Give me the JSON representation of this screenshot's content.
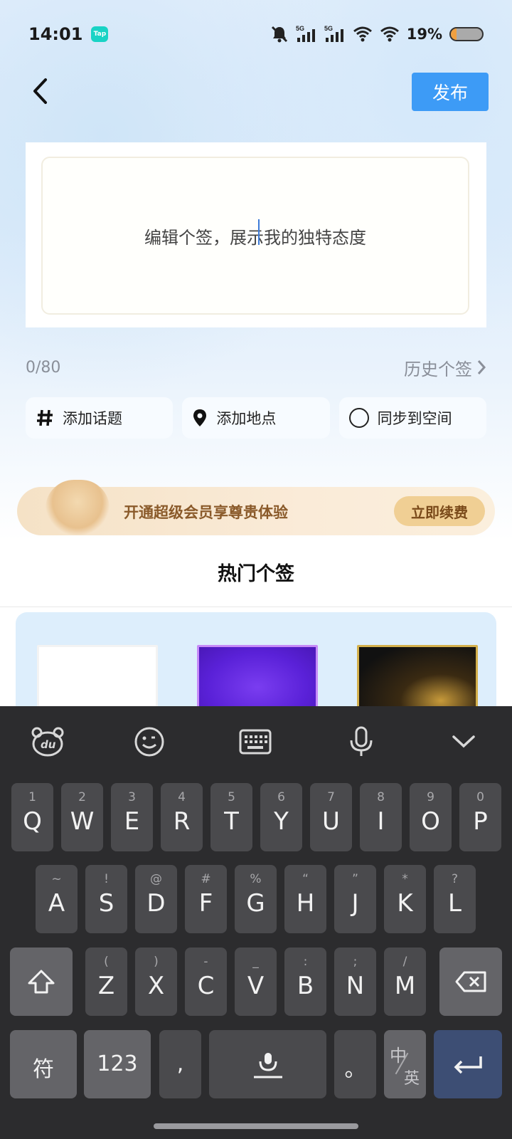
{
  "status_bar": {
    "time": "14:01",
    "app_badge": "Tap",
    "battery": "19%",
    "battery_level": 0.19
  },
  "header": {
    "publish_label": "发布"
  },
  "editor": {
    "placeholder": "编辑个签，展示我的独特态度"
  },
  "meta": {
    "counter": "0/80",
    "history_label": "历史个签"
  },
  "chips": [
    {
      "label": "添加话题",
      "icon": "hash-icon"
    },
    {
      "label": "添加地点",
      "icon": "location-pin-icon"
    },
    {
      "label": "同步到空间",
      "icon": "radio-icon"
    }
  ],
  "vip": {
    "text": "开通超级会员享尊贵体验",
    "button": "立即续费"
  },
  "hot": {
    "title": "热门个签"
  },
  "keyboard": {
    "toolbar": [
      "du-bear-icon",
      "emoji-icon",
      "keyboard-icon",
      "mic-icon",
      "collapse-icon"
    ],
    "row1": [
      {
        "hint": "1",
        "key": "Q"
      },
      {
        "hint": "2",
        "key": "W"
      },
      {
        "hint": "3",
        "key": "E"
      },
      {
        "hint": "4",
        "key": "R"
      },
      {
        "hint": "5",
        "key": "T"
      },
      {
        "hint": "6",
        "key": "Y"
      },
      {
        "hint": "7",
        "key": "U"
      },
      {
        "hint": "8",
        "key": "I"
      },
      {
        "hint": "9",
        "key": "O"
      },
      {
        "hint": "0",
        "key": "P"
      }
    ],
    "row2": [
      {
        "hint": "~",
        "key": "A"
      },
      {
        "hint": "!",
        "key": "S"
      },
      {
        "hint": "@",
        "key": "D"
      },
      {
        "hint": "#",
        "key": "F"
      },
      {
        "hint": "%",
        "key": "G"
      },
      {
        "hint": "“",
        "key": "H"
      },
      {
        "hint": "”",
        "key": "J"
      },
      {
        "hint": "*",
        "key": "K"
      },
      {
        "hint": "?",
        "key": "L"
      }
    ],
    "row3": [
      {
        "hint": "(",
        "key": "Z"
      },
      {
        "hint": ")",
        "key": "X"
      },
      {
        "hint": "-",
        "key": "C"
      },
      {
        "hint": "_",
        "key": "V"
      },
      {
        "hint": ":",
        "key": "B"
      },
      {
        "hint": ";",
        "key": "N"
      },
      {
        "hint": "/",
        "key": "M"
      }
    ],
    "symbols_label": "符",
    "numbers_label": "123",
    "comma_label": ",",
    "period_label": "。",
    "lang_top": "中",
    "lang_bottom": "英"
  }
}
